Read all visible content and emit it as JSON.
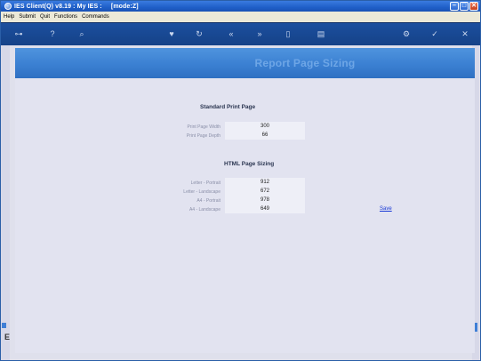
{
  "window": {
    "title": "IES Client(Q) v8.19 : My IES :     [mode:Z]",
    "controls": {
      "minimize": "–",
      "maximize": "□",
      "close": "✕"
    }
  },
  "menu": {
    "items": [
      "Help",
      "Submit",
      "Quit",
      "Functions",
      "Commands"
    ]
  },
  "toolbar": {
    "icons": {
      "key": "⊶",
      "help": "?",
      "search": "⌕",
      "heart": "♥",
      "refresh": "↻",
      "back": "«",
      "forward": "»",
      "doc": "▯",
      "note": "▤",
      "gear": "⚙",
      "check": "✓",
      "close": "✕"
    }
  },
  "page": {
    "title": "Report Page Sizing",
    "standard": {
      "heading": "Standard Print Page",
      "rows": [
        {
          "label": "Print Page Width",
          "value": "300"
        },
        {
          "label": "Print Page Depth",
          "value": "66"
        }
      ]
    },
    "html": {
      "heading": "HTML Page Sizing",
      "rows": [
        {
          "label": "Letter - Portrait",
          "value": "912"
        },
        {
          "label": "Letter - Landscape",
          "value": "672"
        },
        {
          "label": "A4 - Portrait",
          "value": "978"
        },
        {
          "label": "A4 - Landscape",
          "value": "649"
        }
      ]
    },
    "save_label": "Save"
  },
  "side": {
    "e_label": "E"
  },
  "colors": {
    "banner": "#3b80d2",
    "titlebar": "#1f5fc8",
    "toolbar": "#154288",
    "link": "#1a3ad6"
  }
}
